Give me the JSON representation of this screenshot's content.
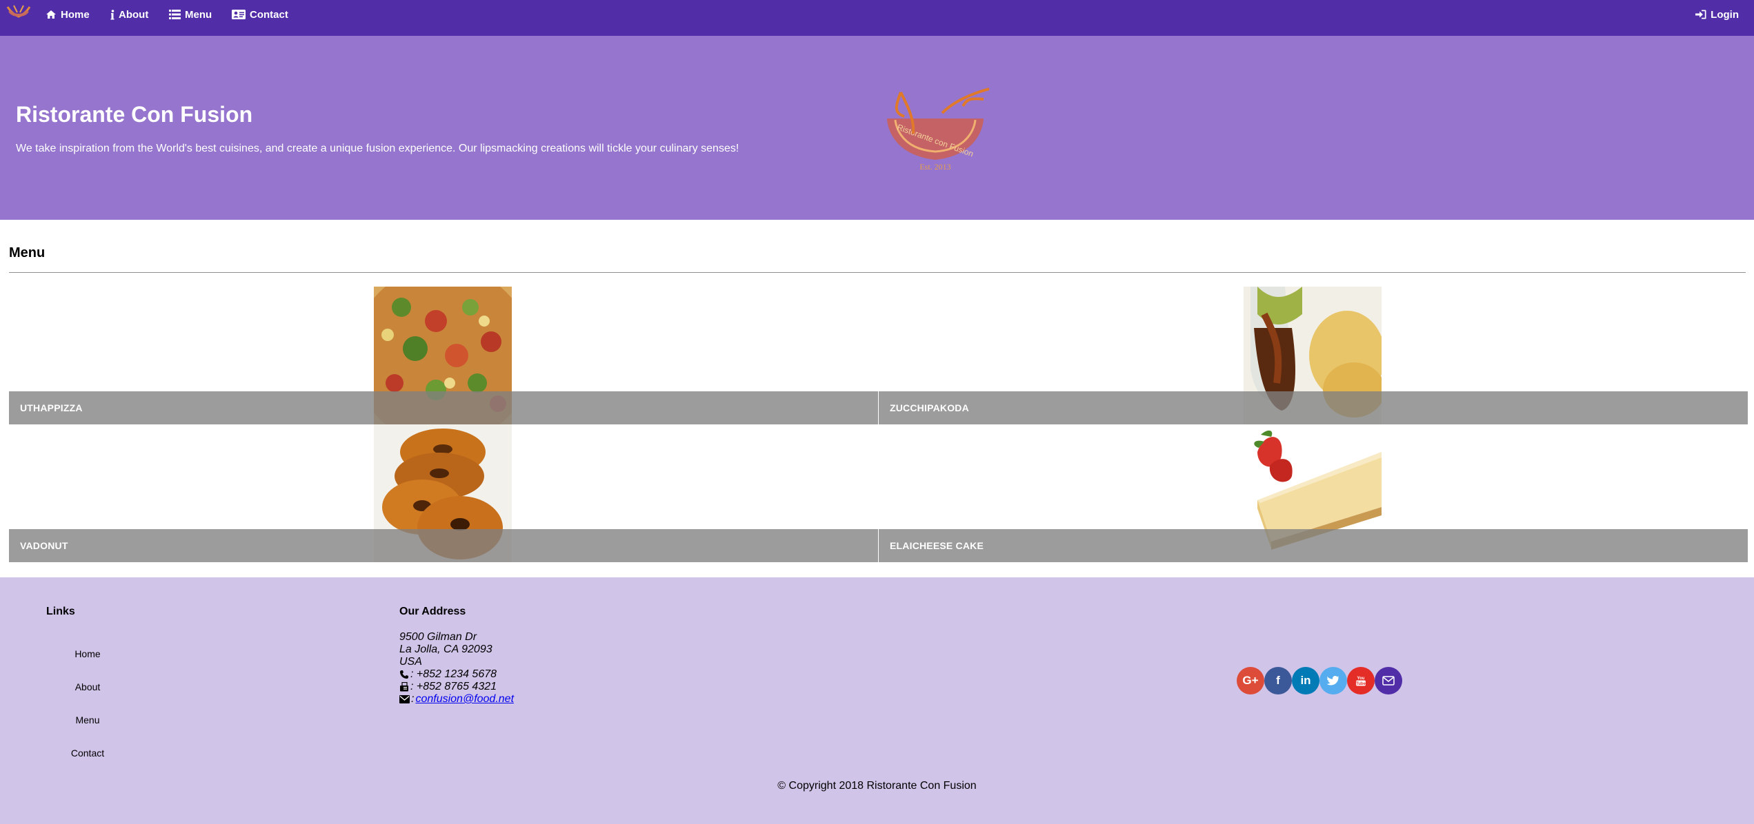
{
  "navbar": {
    "brand_icon": "restaurant-logo-small",
    "items": [
      {
        "label": "Home",
        "icon": "home-icon"
      },
      {
        "label": "About",
        "icon": "info-icon"
      },
      {
        "label": "Menu",
        "icon": "list-icon"
      },
      {
        "label": "Contact",
        "icon": "address-card-icon"
      }
    ],
    "login": {
      "label": "Login",
      "icon": "sign-in-icon"
    },
    "color": "#512DA8"
  },
  "jumbotron": {
    "title": "Ristorante Con Fusion",
    "text": "We take inspiration from the World's best cuisines, and create a unique fusion experience. Our lipsmacking creations will tickle your culinary senses!",
    "logo": "ristorante-con-fusion-logo",
    "color": "#9575CD"
  },
  "menu": {
    "heading": "Menu",
    "dishes": [
      {
        "name": "UTHAPPIZZA",
        "image": "pizza-image"
      },
      {
        "name": "ZUCCHIPAKODA",
        "image": "pakoda-image"
      },
      {
        "name": "VADONUT",
        "image": "donut-image"
      },
      {
        "name": "ELAICHEESE CAKE",
        "image": "cheesecake-image"
      }
    ]
  },
  "footer": {
    "links_heading": "Links",
    "links": [
      "Home",
      "About",
      "Menu",
      "Contact"
    ],
    "address_heading": "Our Address",
    "address_lines": [
      "9500 Gilman Dr",
      "La Jolla, CA 92093",
      "USA"
    ],
    "phone": ": +852 1234 5678",
    "fax": ": +852 8765 4321",
    "email_prefix": ": ",
    "email": "confusion@food.net",
    "socials": [
      {
        "name": "google-plus",
        "glyph": "G+",
        "color": "#DD4B39"
      },
      {
        "name": "facebook",
        "glyph": "f",
        "color": "#3B5998"
      },
      {
        "name": "linkedin",
        "glyph": "in",
        "color": "#007BB6"
      },
      {
        "name": "twitter",
        "glyph": "t",
        "color": "#55ACEE"
      },
      {
        "name": "youtube",
        "glyph": "▶",
        "color": "#E52D27"
      },
      {
        "name": "mail",
        "glyph": "✉",
        "color": "#512DA8"
      }
    ],
    "copyright": "© Copyright 2018 Ristorante Con Fusion",
    "color": "#D1C4E9"
  }
}
